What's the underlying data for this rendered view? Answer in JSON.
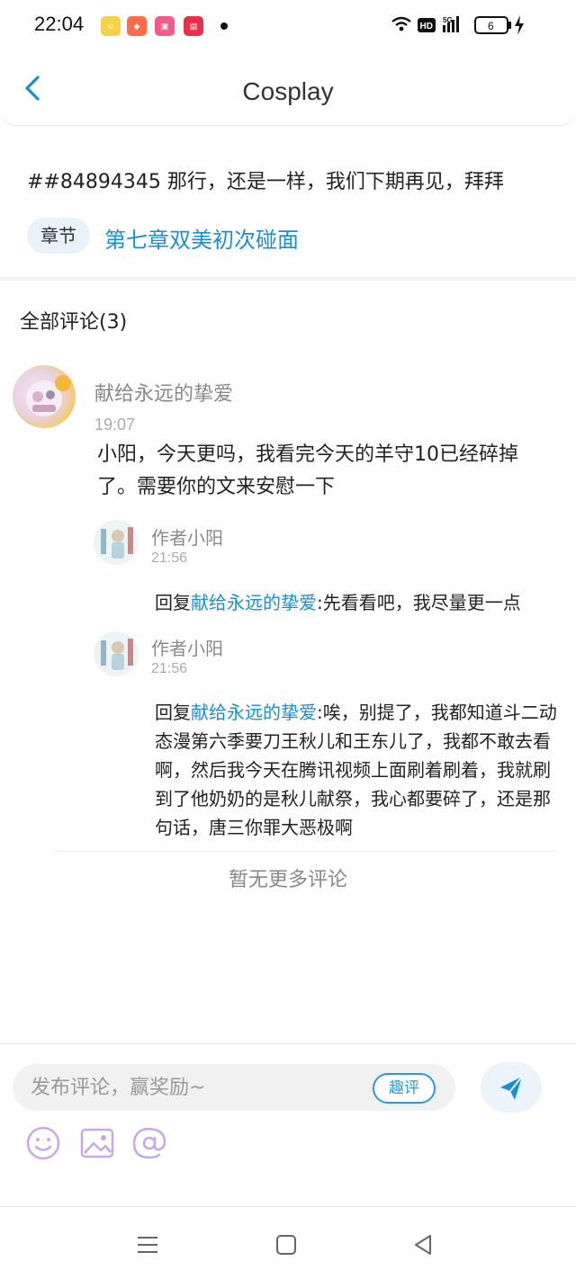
{
  "status_bar": {
    "time": "22:04",
    "battery": "6"
  },
  "header": {
    "title": "Cosplay"
  },
  "post": {
    "text": "##84894345 那行，还是一样，我们下期再见，拜拜",
    "chapter_tag": "章节",
    "chapter_title": "第七章双美初次碰面"
  },
  "comments": {
    "header": "全部评论(3)",
    "main": {
      "author": "献给永远的挚爱",
      "time": "19:07",
      "text": "小阳，今天更吗，我看完今天的羊守10已经碎掉了。需要你的文来安慰一下"
    },
    "replies": [
      {
        "author": "作者小阳",
        "time": "21:56",
        "prefix": "回复",
        "mention": "献给永远的挚爱",
        "text": ":先看看吧，我尽量更一点"
      },
      {
        "author": "作者小阳",
        "time": "21:56",
        "prefix": "回复",
        "mention": "献给永远的挚爱",
        "text": ":唉，别提了，我都知道斗二动态漫第六季要刀王秋儿和王东儿了，我都不敢去看啊，然后我今天在腾讯视频上面刷着刷着，我就刷到了他奶奶的是秋儿献祭，我心都要碎了，还是那句话，唐三你罪大恶极啊"
      }
    ],
    "no_more": "暂无更多评论"
  },
  "composer": {
    "placeholder": "发布评论，赢奖励~",
    "quping_label": "趣评"
  },
  "colors": {
    "accent": "#1a8fd0",
    "tool_purple": "#c8a8e8"
  }
}
